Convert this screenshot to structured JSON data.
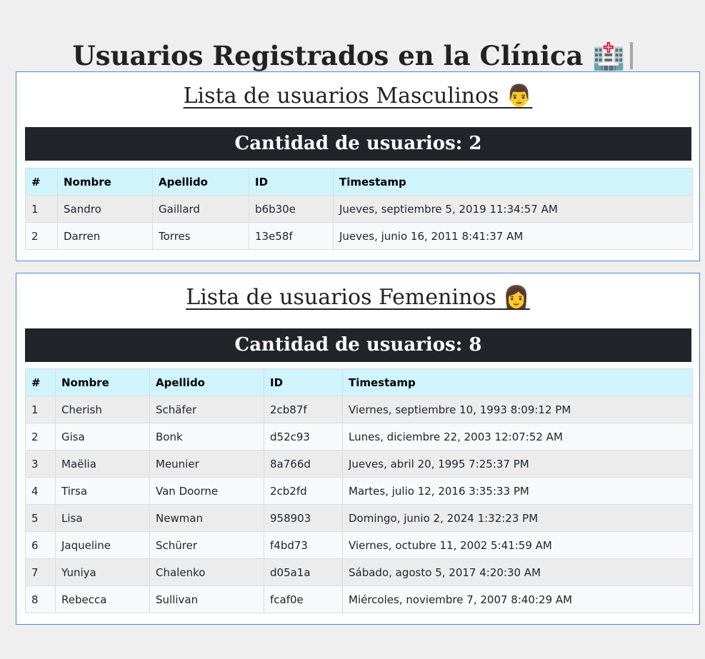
{
  "page": {
    "title": "Usuarios Registrados en la Clínica",
    "title_emoji": "🏥"
  },
  "male": {
    "heading": "Lista de usuarios Masculinos",
    "heading_emoji": "👨",
    "count_label": "Cantidad de usuarios: 2",
    "columns": [
      "#",
      "Nombre",
      "Apellido",
      "ID",
      "Timestamp"
    ],
    "rows": [
      [
        "1",
        "Sandro",
        "Gaillard",
        "b6b30e",
        "Jueves, septiembre 5, 2019 11:34:57 AM"
      ],
      [
        "2",
        "Darren",
        "Torres",
        "13e58f",
        "Jueves, junio 16, 2011 8:41:37 AM"
      ]
    ]
  },
  "female": {
    "heading": "Lista de usuarios Femeninos",
    "heading_emoji": "👩",
    "count_label": "Cantidad de usuarios: 8",
    "columns": [
      "#",
      "Nombre",
      "Apellido",
      "ID",
      "Timestamp"
    ],
    "rows": [
      [
        "1",
        "Cherish",
        "Schäfer",
        "2cb87f",
        "Viernes, septiembre 10, 1993 8:09:12 PM"
      ],
      [
        "2",
        "Gisa",
        "Bonk",
        "d52c93",
        "Lunes, diciembre 22, 2003 12:07:52 AM"
      ],
      [
        "3",
        "Maëlia",
        "Meunier",
        "8a766d",
        "Jueves, abril 20, 1995 7:25:37 PM"
      ],
      [
        "4",
        "Tirsa",
        "Van Doorne",
        "2cb2fd",
        "Martes, julio 12, 2016 3:35:33 PM"
      ],
      [
        "5",
        "Lisa",
        "Newman",
        "958903",
        "Domingo, junio 2, 2024 1:32:23 PM"
      ],
      [
        "6",
        "Jaqueline",
        "Schürer",
        "f4bd73",
        "Viernes, octubre 11, 2002 5:41:59 AM"
      ],
      [
        "7",
        "Yuniya",
        "Chalenko",
        "d05a1a",
        "Sábado, agosto 5, 2017 4:20:30 AM"
      ],
      [
        "8",
        "Rebecca",
        "Sullivan",
        "fcaf0e",
        "Miércoles, noviembre 7, 2007 8:40:29 AM"
      ]
    ]
  },
  "colors": {
    "page_bg": "#efefef",
    "card_border": "#4a89d6",
    "count_bar_bg": "#212529",
    "header_bg": "#cff4fc",
    "row_odd_bg": "#ececec",
    "row_even_bg": "#f8f9fa"
  }
}
